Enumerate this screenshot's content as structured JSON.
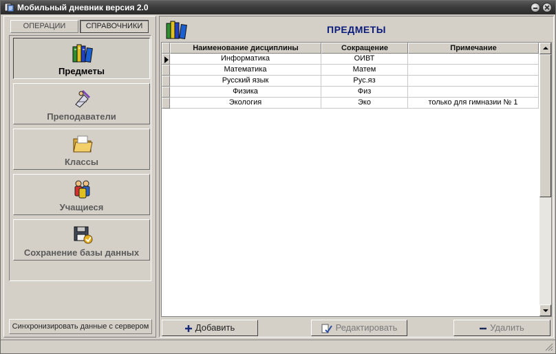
{
  "window": {
    "title": "Мобильный дневник версия 2.0"
  },
  "tabs": [
    {
      "label": "ОПЕРАЦИИ",
      "active": false
    },
    {
      "label": "СПРАВОЧНИКИ",
      "active": true
    }
  ],
  "nav": [
    {
      "label": "Предметы",
      "icon": "books-icon",
      "active": true
    },
    {
      "label": "Преподаватели",
      "icon": "teacher-icon",
      "active": false
    },
    {
      "label": "Классы",
      "icon": "folder-icon",
      "active": false
    },
    {
      "label": "Учащиеся",
      "icon": "students-icon",
      "active": false
    },
    {
      "label": "Сохранение базы данных",
      "icon": "database-save-icon",
      "active": false
    }
  ],
  "sync_button": {
    "label": "Синхронизировать данные с сервером"
  },
  "panel": {
    "title": "ПРЕДМЕТЫ",
    "icon": "books-icon"
  },
  "table": {
    "columns": [
      "Наименование дисциплины",
      "Сокращение",
      "Примечание"
    ],
    "selected_row": 0,
    "rows": [
      [
        "Информатика",
        "ОИВТ",
        ""
      ],
      [
        "Математика",
        "Матем",
        ""
      ],
      [
        "Русский язык",
        "Рус.яз",
        ""
      ],
      [
        "Физика",
        "Физ",
        ""
      ],
      [
        "Экология",
        "Эко",
        "только для гимназии № 1"
      ]
    ]
  },
  "actions": {
    "add": {
      "label": "Добавить",
      "icon": "plus-icon",
      "enabled": true
    },
    "edit": {
      "label": "Редактировать",
      "icon": "edit-icon",
      "enabled": false
    },
    "delete": {
      "label": "Удалить",
      "icon": "minus-icon",
      "enabled": false
    }
  },
  "colors": {
    "title_text": "#0a1a7a",
    "face": "#d4d0c8"
  }
}
